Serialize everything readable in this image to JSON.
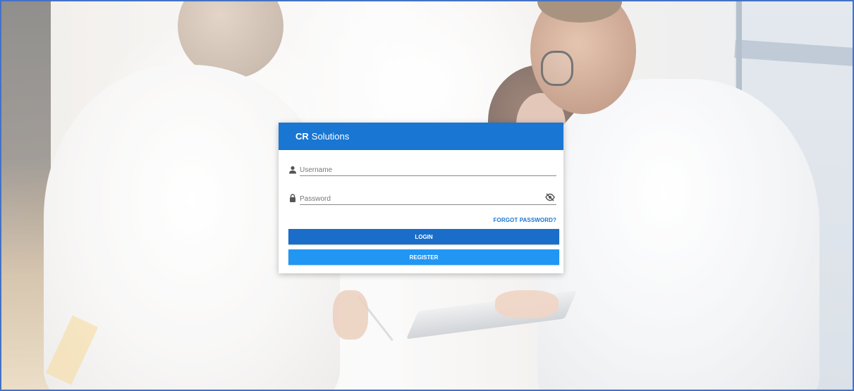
{
  "card": {
    "brand": "CR",
    "title": "Solutions"
  },
  "username": {
    "placeholder": "Username",
    "icon": "person-icon"
  },
  "password": {
    "placeholder": "Password",
    "icon": "lock-icon",
    "toggle_icon": "eye-slash-icon"
  },
  "links": {
    "forgot_password": "FORGOT PASSWORD?"
  },
  "buttons": {
    "login": "LOGIN",
    "register": "REGISTER"
  },
  "colors": {
    "header": "#1976d2",
    "login_button": "#1a6ec9",
    "register_button": "#2196f3",
    "frame_border": "#4472c4"
  }
}
